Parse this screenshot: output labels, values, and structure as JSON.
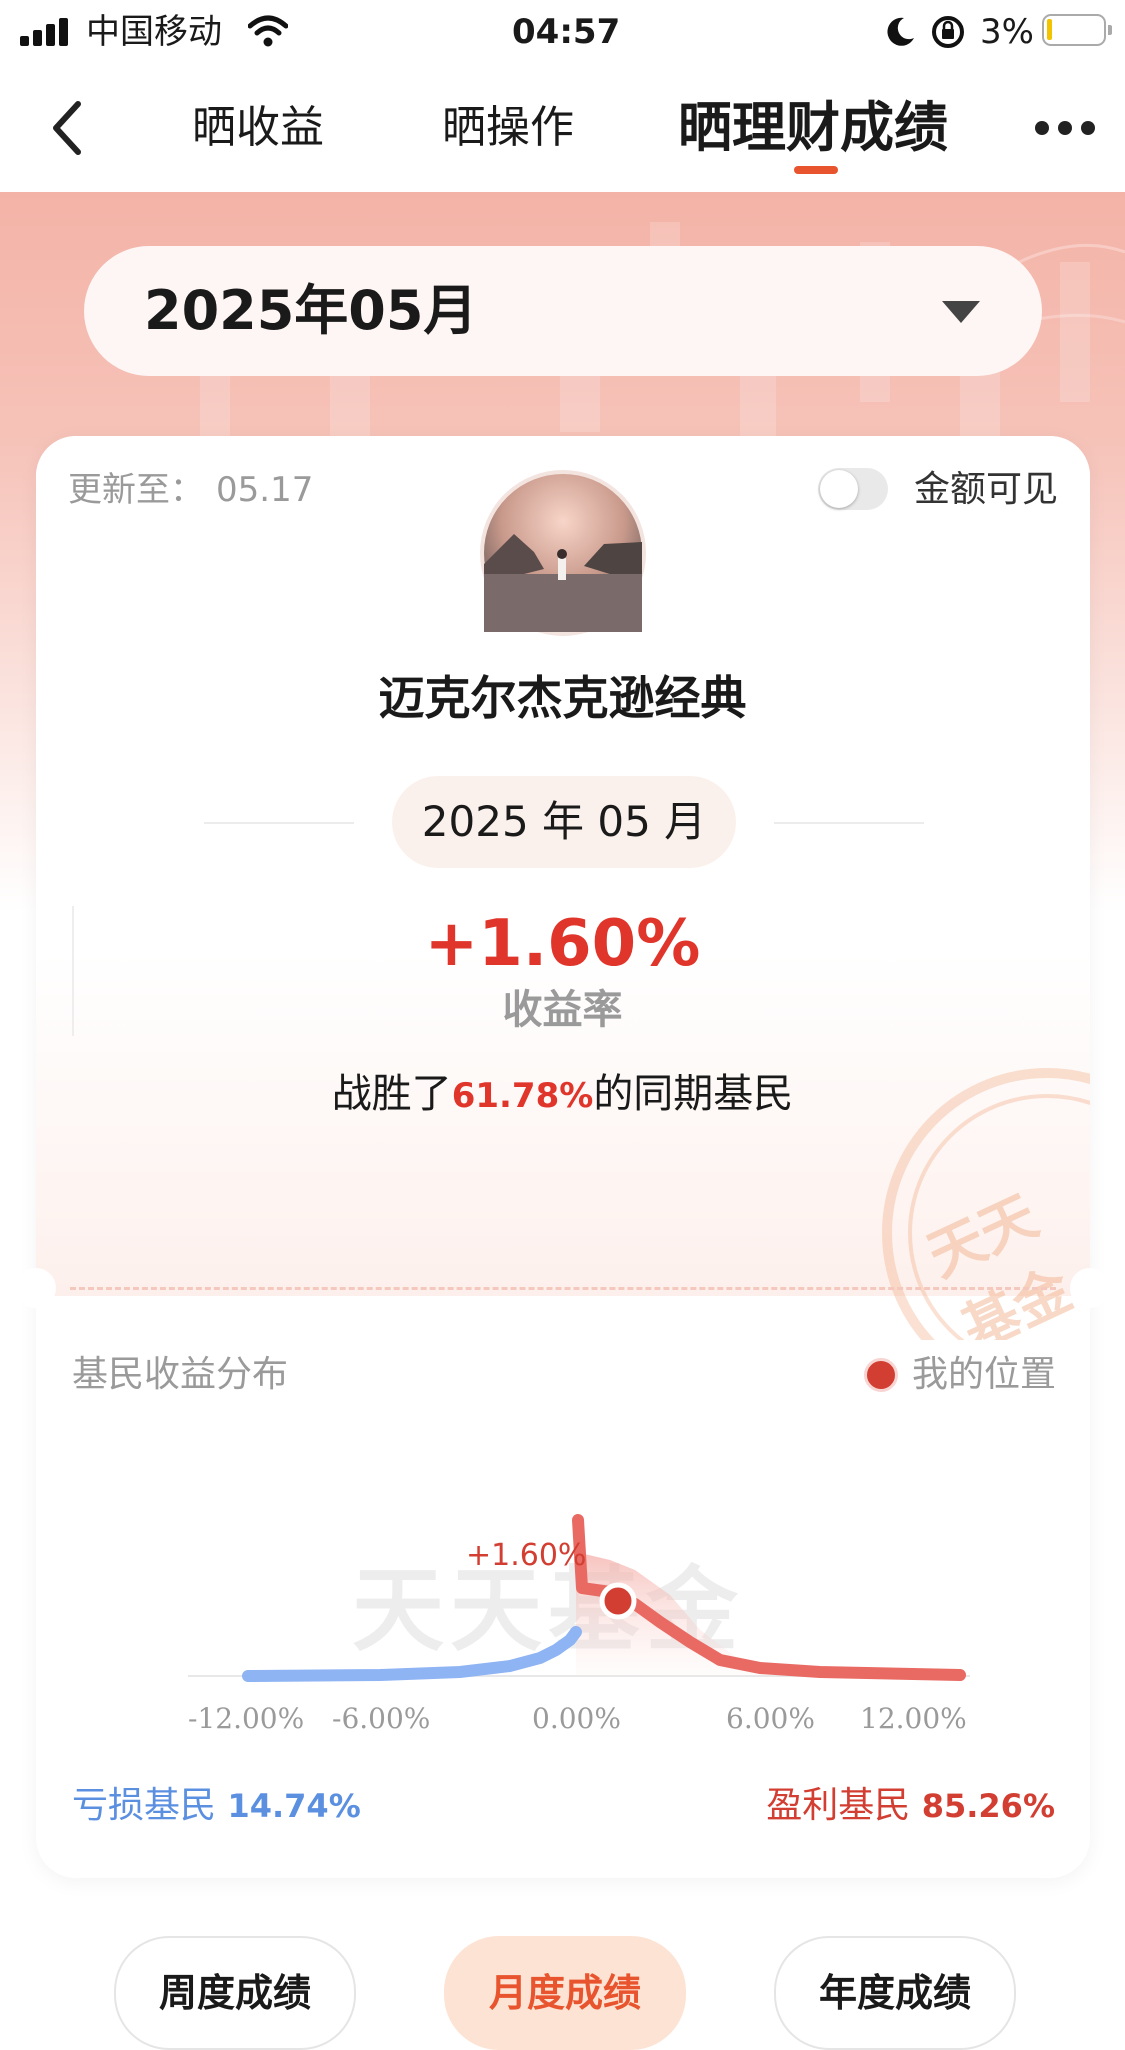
{
  "status_bar": {
    "carrier": "中国移动",
    "time": "04:57",
    "battery": "3%",
    "icons": [
      "signal-icon",
      "wifi-icon",
      "moon-icon",
      "rotation-lock-icon",
      "battery-icon"
    ]
  },
  "nav": {
    "tabs": [
      {
        "label": "晒收益",
        "active": false
      },
      {
        "label": "晒操作",
        "active": false
      },
      {
        "label": "晒理财成绩",
        "active": true
      }
    ],
    "accent": "#e8542d"
  },
  "month_selector": {
    "value": "2025年05月"
  },
  "card": {
    "updated_label": "更新至：",
    "updated_value": "05.17",
    "toggle_label": "金额可见",
    "toggle_on": false,
    "username": "迈克尔杰克逊经典",
    "period": "2025 年 05 月",
    "return_value": "+1.60%",
    "return_label": "收益率",
    "beat_prefix": "战胜了",
    "beat_value": "61.78%",
    "beat_suffix": "的同期基民",
    "stamp_text": "天天基金",
    "distribution": {
      "title": "基民收益分布",
      "legend": "我的位置",
      "watermark": "天天基金",
      "marker_label": "+1.60%",
      "ticks": [
        "-12.00%",
        "-6.00%",
        "0.00%",
        "6.00%",
        "12.00%"
      ],
      "loss_label": "亏损基民",
      "loss_value": "14.74%",
      "profit_label": "盈利基民",
      "profit_value": "85.26%",
      "colors": {
        "loss": "#8fb4f4",
        "profit": "#e96a63",
        "marker": "#d23f32"
      }
    }
  },
  "bottom_tabs": [
    {
      "label": "周度成绩",
      "active": false
    },
    {
      "label": "月度成绩",
      "active": true
    },
    {
      "label": "年度成绩",
      "active": false
    }
  ]
}
